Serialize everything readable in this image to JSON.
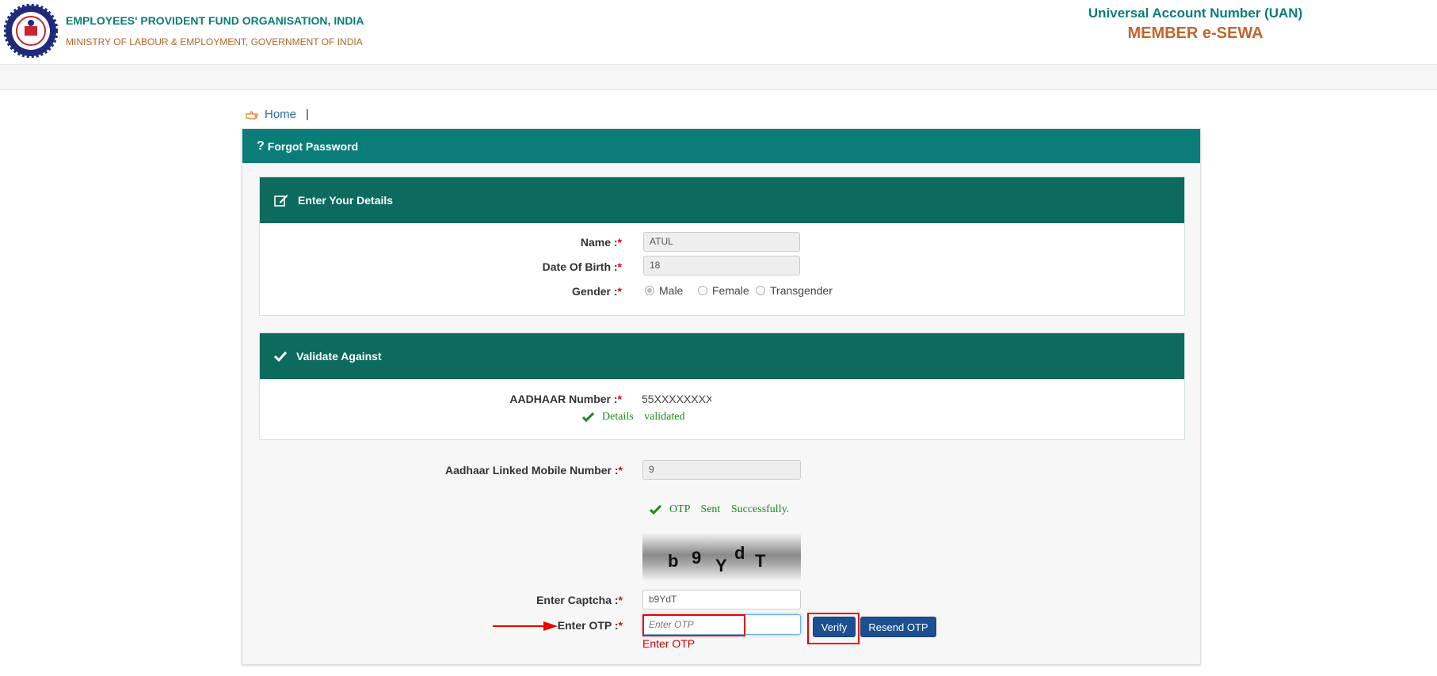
{
  "header": {
    "org_name": "EMPLOYEES' PROVIDENT FUND ORGANISATION, INDIA",
    "ministry": "MINISTRY OF LABOUR & EMPLOYMENT, GOVERNMENT OF INDIA",
    "uan_title": "Universal Account Number (UAN)",
    "portal_title": "MEMBER e-SEWA"
  },
  "breadcrumb": {
    "home": "Home",
    "separator": "|"
  },
  "panel": {
    "title": "Forgot Password"
  },
  "details": {
    "title": "Enter Your Details",
    "name_label": "Name :",
    "name_value": "ATUL",
    "dob_label": "Date Of Birth :",
    "dob_value": "18",
    "gender_label": "Gender :",
    "gender_options": [
      "Male",
      "Female",
      "Transgender"
    ],
    "gender_selected": "Male"
  },
  "validate": {
    "title": "Validate Against",
    "aadhaar_label": "AADHAAR Number :",
    "aadhaar_value": "55XXXXXXXX",
    "status": "Details validated"
  },
  "otp_section": {
    "mobile_label": "Aadhaar Linked Mobile Number :",
    "mobile_value": "9",
    "otp_status": "OTP Sent Successfully.",
    "captcha_chars": [
      "b",
      "9",
      "Y",
      "d",
      "T"
    ],
    "captcha_label": "Enter Captcha :",
    "captcha_value": "b9YdT",
    "otp_label": "Enter OTP :",
    "otp_placeholder": "Enter OTP",
    "verify_label": "Verify",
    "resend_label": "Resend OTP",
    "otp_error": "Enter OTP"
  },
  "required_mark": "*",
  "colors": {
    "teal": "#0a7d7a",
    "dark_teal": "#0c6a5f",
    "button": "#1c4f91",
    "annotation": "#ee0000"
  }
}
